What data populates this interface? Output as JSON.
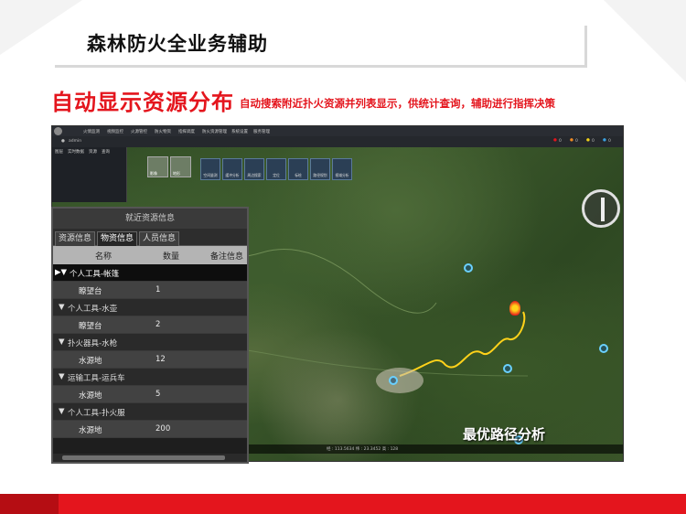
{
  "slide": {
    "title": "森林防火全业务辅助",
    "headline": "自动显示资源分布",
    "subheadline": "自动搜索附近扑火资源并列表显示，供统计查询，辅助进行指挥决策",
    "route_label": "最优路径分析",
    "colors": {
      "accent": "#e4151d",
      "footer_dark": "#b50d13"
    }
  },
  "app": {
    "menu_items": [
      "火情监测",
      "视频监控",
      "火源管控",
      "防火物资",
      "指挥调度",
      "防火资源管理",
      "系统设置",
      "服务管理"
    ],
    "user": "admin",
    "status_dots": [
      {
        "color": "#e4151d",
        "label": "0"
      },
      {
        "color": "#f08a24",
        "label": "0"
      },
      {
        "color": "#f2d21a",
        "label": "0"
      },
      {
        "color": "#3aa0e0",
        "label": "0"
      }
    ],
    "left_tabs": [
      "图层",
      "实时数据",
      "资源",
      "查询"
    ],
    "toolbar": [
      "空间量测",
      "缓冲分析",
      "周边搜索",
      "定位",
      "标绘",
      "路径规划",
      "视域分析"
    ],
    "thumbs": [
      "影像",
      "地形"
    ],
    "status_text": "经 : 113.5634  纬 : 23.3452  高 : 128"
  },
  "resource_panel": {
    "title": "就近资源信息",
    "tabs": [
      "资源信息",
      "物资信息",
      "人员信息"
    ],
    "active_tab": 1,
    "columns": [
      "名称",
      "数量",
      "备注信息"
    ],
    "rows": [
      {
        "type": "group",
        "label": "个人工具-帐篷",
        "selected": true
      },
      {
        "type": "item",
        "name": "瞭望台",
        "count": "1"
      },
      {
        "type": "group",
        "label": "个人工具-水壶"
      },
      {
        "type": "item",
        "name": "瞭望台",
        "count": "2"
      },
      {
        "type": "group",
        "label": "扑火器具-水枪"
      },
      {
        "type": "item",
        "name": "水源地",
        "count": "12"
      },
      {
        "type": "group",
        "label": "运输工具-运兵车"
      },
      {
        "type": "item",
        "name": "水源地",
        "count": "5"
      },
      {
        "type": "group",
        "label": "个人工具-扑火服"
      },
      {
        "type": "item",
        "name": "水源地",
        "count": "200"
      }
    ]
  }
}
